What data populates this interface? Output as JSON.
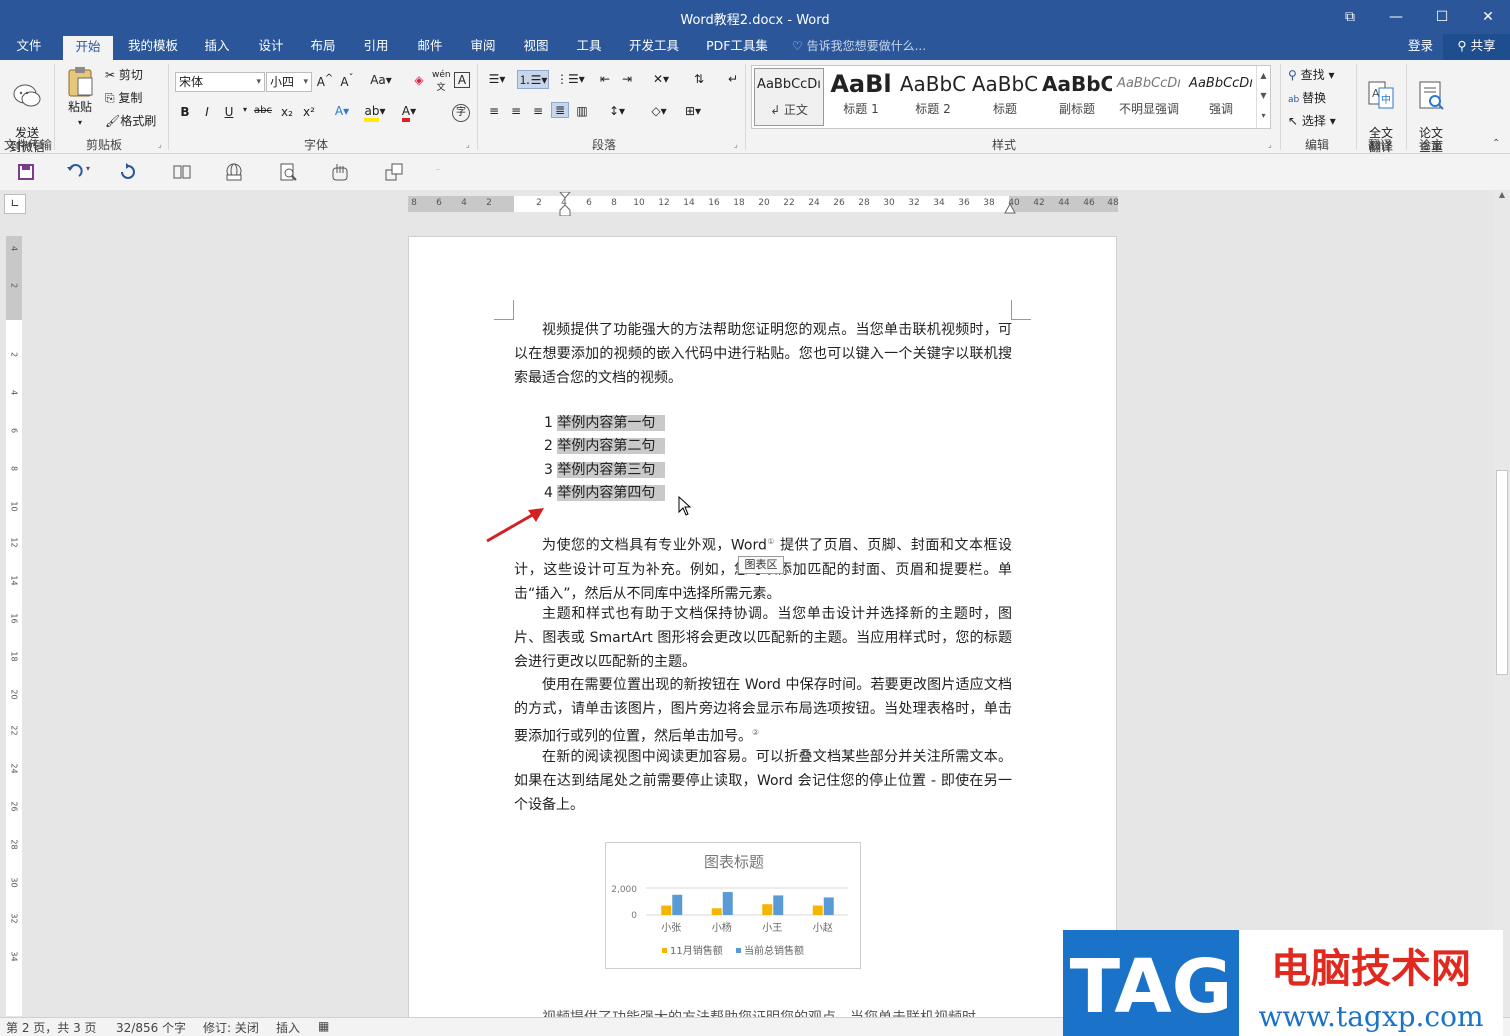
{
  "window": {
    "title": "Word教程2.docx - Word",
    "restore_glyph": "⧉",
    "minimize_glyph": "—",
    "maximize_glyph": "☐",
    "close_glyph": "✕"
  },
  "tabs": [
    "文件",
    "开始",
    "我的模板",
    "插入",
    "设计",
    "布局",
    "引用",
    "邮件",
    "审阅",
    "视图",
    "工具",
    "开发工具",
    "PDF工具集"
  ],
  "active_tab": "开始",
  "tell_me": "告诉我您想要做什么...",
  "account": {
    "login": "登录",
    "share": "共享"
  },
  "ribbon": {
    "send_wechat": "发送\n到微信",
    "file_transfer_group": "文件传输",
    "paste": "粘贴",
    "cut": "剪切",
    "copy": "复制",
    "format_painter": "格式刷",
    "clipboard_group": "剪贴板",
    "font_name": "宋体",
    "font_size": "小四",
    "font_group": "字体",
    "paragraph_group": "段落",
    "styles": [
      {
        "sample": "AaBbCcDı",
        "name": "↲ 正文"
      },
      {
        "sample": "AaBl",
        "name": "标题 1"
      },
      {
        "sample": "AaBbC",
        "name": "标题 2"
      },
      {
        "sample": "AaBbC",
        "name": "标题"
      },
      {
        "sample": "AaBbC",
        "name": "副标题"
      },
      {
        "sample": "AaBbCcDı",
        "name": "不明显强调"
      },
      {
        "sample": "AaBbCcDı",
        "name": "强调"
      }
    ],
    "styles_group": "样式",
    "find": "查找",
    "replace": "替换",
    "select": "选择",
    "editing_group": "编辑",
    "full_translate": "全文\n翻译",
    "translate_group": "翻译",
    "paper_check": "论文\n查重",
    "paper_group": "论文"
  },
  "ruler": {
    "h_left_numbers": [
      "8",
      "6",
      "4",
      "2"
    ],
    "h_right_numbers": [
      "2",
      "4",
      "6",
      "8",
      "10",
      "12",
      "14",
      "16",
      "18",
      "20",
      "22",
      "24",
      "26",
      "28",
      "30",
      "32",
      "34",
      "36",
      "38",
      "40",
      "42",
      "44",
      "46",
      "48"
    ],
    "v_numbers": [
      "4",
      "2",
      "2",
      "4",
      "6",
      "8",
      "10",
      "12",
      "14",
      "16",
      "18",
      "20",
      "22",
      "24",
      "26",
      "28",
      "30",
      "32",
      "34"
    ]
  },
  "document": {
    "para1": "视频提供了功能强大的方法帮助您证明您的观点。当您单击联机视频时，可以在想要添加的视频的嵌入代码中进行粘贴。您也可以键入一个关键字以联机搜索最适合您的文档的视频。",
    "list": [
      {
        "num": "1",
        "text": "举例内容第一句"
      },
      {
        "num": "2",
        "text": "举例内容第二句"
      },
      {
        "num": "3",
        "text": "举例内容第三句"
      },
      {
        "num": "4",
        "text": "举例内容第四句"
      }
    ],
    "para2_a": "为使您的文档具有专业外观，Word",
    "para2_sup": "①",
    "para2_b": " 提供了页眉、页脚、封面和文本框设计，这些设计可互为补充。例如，您可以添加匹配的封面、页眉和提要栏。单击“插入”，然后从不同库中选择所需元素。",
    "para3": "主题和样式也有助于文档保持协调。当您单击设计并选择新的主题时，图片、图表或 SmartArt 图形将会更改以匹配新的主题。当应用样式时，您的标题会进行更改以匹配新的主题。",
    "para4_a": "使用在需要位置出现的新按钮在 Word 中保存时间。若要更改图片适应文档的方式，请单击该图片，图片旁边将会显示布局选项按钮。当处理表格时，单击要添加行或列的位置，然后单击加号。",
    "para4_sup": "②",
    "para5": "在新的阅读视图中阅读更加容易。可以折叠文档某些部分并关注所需文本。如果在达到结尾处之前需要停止读取，Word 会记住您的停止位置 - 即使在另一个设备上。",
    "para6": "视频提供了功能强大的方法帮助您证明您的观点。当您单击联机视频时",
    "tooltip": "图表区"
  },
  "chart_data": {
    "type": "bar",
    "title": "图表标题",
    "categories": [
      "小张",
      "小杨",
      "小王",
      "小赵"
    ],
    "series": [
      {
        "name": "11月销售额",
        "values": [
          700,
          500,
          800,
          700
        ],
        "color": "#f5b500"
      },
      {
        "name": "当前总销售额",
        "values": [
          1500,
          1700,
          1450,
          1300
        ],
        "color": "#5b9bd5"
      }
    ],
    "ylim": [
      0,
      2000
    ],
    "yticks": [
      "2,000",
      "0"
    ],
    "legend": "bottom",
    "grid": true
  },
  "status": {
    "page": "第 2 页，共 3 页",
    "words": "32/856 个字",
    "revision": "修订: 关闭",
    "insert": "插入"
  },
  "watermark": {
    "tag": "TAG",
    "site_name": "电脑技术网",
    "url": "www.tagxp.com"
  },
  "colors": {
    "accent": "#2b579a",
    "watermark_red": "#e02a20",
    "watermark_blue": "#1a73c9"
  }
}
